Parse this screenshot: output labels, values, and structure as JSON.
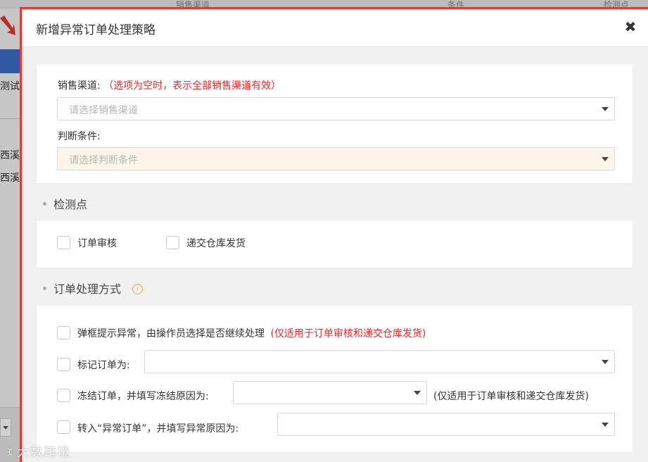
{
  "background": {
    "column_headers": [
      "销售渠道",
      "条件",
      "检测点"
    ],
    "cells": [
      "测试",
      "西溪",
      "西溪"
    ]
  },
  "dialog": {
    "title": "新增异常订单处理策略",
    "close_glyph": "✖",
    "channel": {
      "label": "销售渠道:",
      "hint": "（选项为空时，表示全部销售渠道有效）",
      "placeholder": "请选择销售渠道"
    },
    "condition": {
      "label": "判断条件:",
      "placeholder": "请选择判断条件"
    },
    "checkpoints": {
      "title": "检测点",
      "options": [
        "订单审核",
        "递交仓库发货"
      ]
    },
    "handling": {
      "title": "订单处理方式",
      "info_glyph": "i",
      "options": {
        "popup": {
          "label": "弹框提示异常，由操作员选择是否继续处理",
          "hint": "(仅适用于订单审核和递交仓库发货)"
        },
        "mark": {
          "label": "标记订单为:"
        },
        "freeze": {
          "label": "冻结订单，并填写冻结原因为:",
          "hint": "(仅适用于订单审核和递交仓库发货)"
        },
        "transfer": {
          "label": "转入“异常订单”，并填写异常原因为:"
        }
      }
    }
  },
  "watermark": {
    "glyph": "ꉂ",
    "text": "大数跨境"
  },
  "colors": {
    "accent_red": "#e62b2b",
    "border_red": "#e53935",
    "info_orange": "#f0a23c",
    "highlight_field": "#fdf6e8",
    "bg_tab_blue": "#3b6cc7"
  }
}
